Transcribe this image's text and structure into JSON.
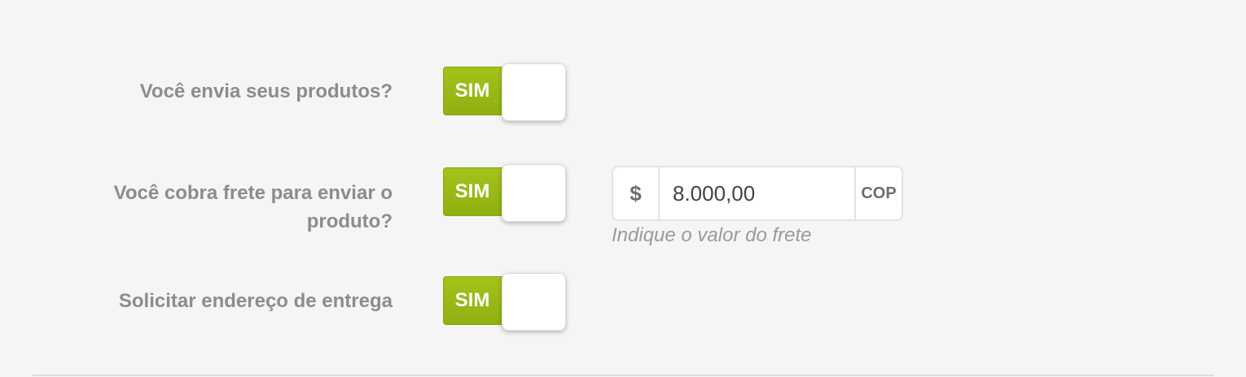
{
  "shipping_form": {
    "ships_products": {
      "label": "Você envia seus produtos?",
      "toggle_label": "SIM",
      "enabled": true
    },
    "charges_shipping": {
      "label": "Você cobra frete para enviar o produto?",
      "toggle_label": "SIM",
      "enabled": true
    },
    "shipping_price": {
      "currency_symbol": "$",
      "value": "8.000,00",
      "currency_code": "COP",
      "help_text": "Indique o valor do frete"
    },
    "request_address": {
      "label": "Solicitar endereço de entrega",
      "toggle_label": "SIM",
      "enabled": true
    }
  },
  "colors": {
    "toggle_on": "#9dbc14",
    "label_text": "#8c8c8c",
    "background": "#f5f5f5"
  }
}
